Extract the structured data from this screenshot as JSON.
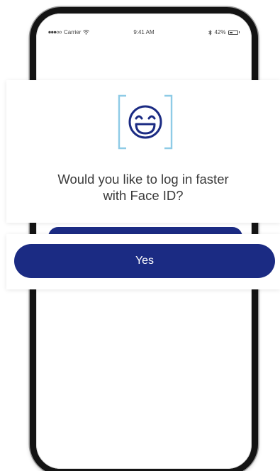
{
  "status_bar": {
    "carrier": "Carrier",
    "time": "9:41 AM",
    "battery_percent": "42%",
    "battery_level": 0.42,
    "signal_icon": "signal-dots-icon",
    "wifi_icon": "wifi-icon",
    "bluetooth_icon": "bluetooth-icon"
  },
  "prompt": {
    "icon": "face-id-smile-icon",
    "title": "Would you like to log in faster\nwith Face ID?",
    "yes_label": "Yes"
  },
  "colors": {
    "primary": "#1b2b83",
    "face_icon": "#1b2b83",
    "face_bracket": "#8ecbe6",
    "text": "#3a3a3a"
  }
}
